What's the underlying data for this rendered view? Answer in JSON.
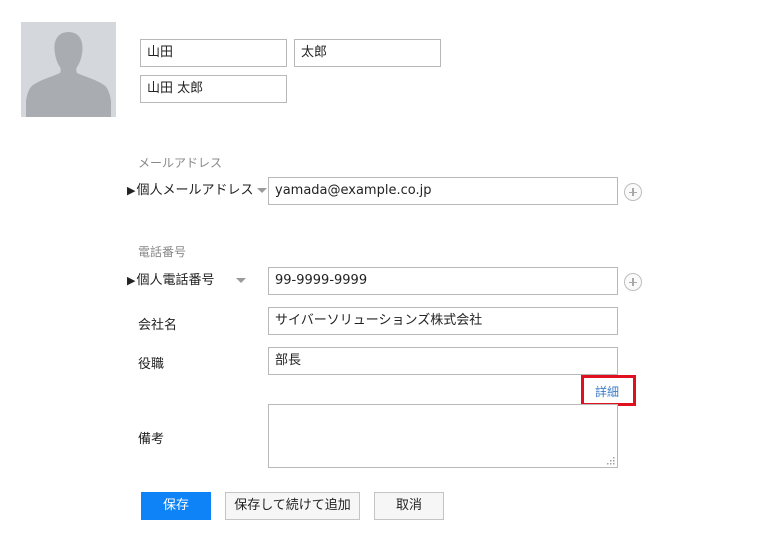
{
  "contact": {
    "last_name": "山田",
    "first_name": "太郎",
    "display_name": "山田 太郎"
  },
  "email": {
    "section_label": "メールアドレス",
    "type_label": "個人メールアドレス",
    "marker": "▶",
    "value": "yamada@example.co.jp"
  },
  "phone": {
    "section_label": "電話番号",
    "type_label": "個人電話番号",
    "marker": "▶",
    "value": "99-9999-9999"
  },
  "company": {
    "label": "会社名",
    "value": "サイバーソリューションズ株式会社"
  },
  "position": {
    "label": "役職",
    "value": "部長",
    "details_link": "詳細"
  },
  "notes": {
    "label": "備考",
    "value": ""
  },
  "buttons": {
    "save": "保存",
    "save_and_add": "保存して続けて追加",
    "cancel": "取消"
  },
  "colors": {
    "primary": "#0d83f7",
    "highlight": "#e0111f",
    "link": "#3a7dc9",
    "avatar_bg": "#d4d8dc"
  },
  "icons": {
    "avatar": "person-silhouette-icon",
    "add": "plus-circle-icon",
    "dropdown": "caret-down-icon",
    "resize": "resize-grip-icon"
  }
}
